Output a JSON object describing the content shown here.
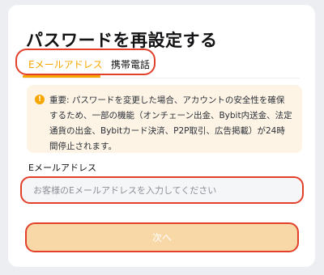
{
  "page": {
    "title": "パスワードを再設定する"
  },
  "tabs": [
    {
      "label": "Eメールアドレス",
      "active": true
    },
    {
      "label": "携帯電話",
      "active": false
    }
  ],
  "notice": {
    "icon": "warning-icon",
    "icon_glyph": "!",
    "text": "重要: パスワードを変更した場合、アカウントの安全性を確保するため、一部の機能（オンチェーン出金、Bybit内送金、法定通貨の出金、Bybitカード決済、P2P取引、広告掲載）が24時間停止されます。"
  },
  "email_field": {
    "label": "Eメールアドレス",
    "value": "",
    "placeholder": "お客様のEメールアドレスを入力してください"
  },
  "next_button": {
    "label": "次へ",
    "enabled": false
  },
  "colors": {
    "accent": "#f7a600",
    "highlight_border": "#e2402b",
    "notice_background": "#fdf4e6",
    "disabled_button": "#f9d8a8"
  }
}
